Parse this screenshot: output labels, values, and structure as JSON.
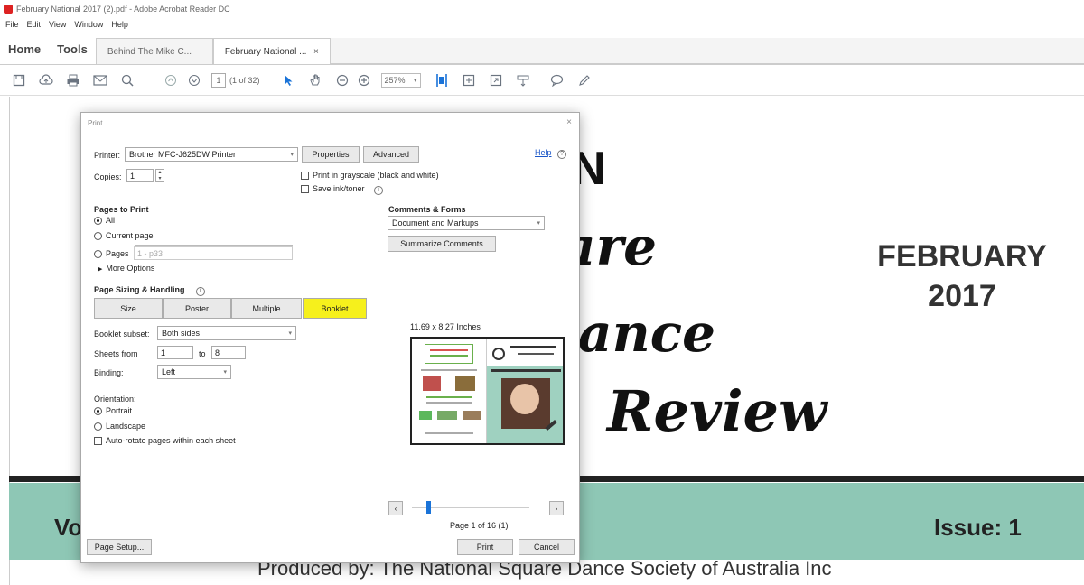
{
  "window": {
    "title": "February National 2017 (2).pdf - Adobe Acrobat Reader DC"
  },
  "menu": [
    "File",
    "Edit",
    "View",
    "Window",
    "Help"
  ],
  "tabs": {
    "home": "Home",
    "tools": "Tools",
    "doc1": "Behind The Mike C...",
    "doc2": "February National ...",
    "close": "×"
  },
  "toolbar": {
    "page_current": "1",
    "page_of": "(1 of 32)",
    "zoom": "257%",
    "icons": [
      "save-icon",
      "upload-icon",
      "print-icon",
      "email-icon",
      "search-icon",
      "page-up-icon",
      "page-down-icon",
      "select-arrow-icon",
      "hand-icon",
      "zoom-out-icon",
      "zoom-in-icon",
      "fit-page-icon",
      "scroll-icon",
      "fullscreen-icon",
      "read-mode-icon",
      "comment-icon",
      "pen-icon"
    ]
  },
  "document": {
    "title_fragment": "N",
    "script_line1": "are",
    "script_line2": "ance",
    "script_line3": "Review",
    "month": "FEBRUARY",
    "year": "2017",
    "volume_fragment": "Vo",
    "issue": "Issue: 1",
    "produced_by": "Produced by: The National Square Dance Society of Australia Inc"
  },
  "dialog": {
    "title": "Print",
    "close": "×",
    "help": "Help",
    "printer_label": "Printer:",
    "printer_value": "Brother MFC-J625DW Printer",
    "properties": "Properties",
    "advanced": "Advanced",
    "copies_label": "Copies:",
    "copies_value": "1",
    "grayscale": "Print in grayscale (black and white)",
    "save_ink": "Save ink/toner",
    "pages_to_print": "Pages to Print",
    "all": "All",
    "current_page": "Current page",
    "pages": "Pages",
    "pages_value": "1 - p33",
    "more_options": "More Options",
    "comments_forms": "Comments & Forms",
    "comments_value": "Document and Markups",
    "summarize": "Summarize Comments",
    "page_sizing": "Page Sizing & Handling",
    "size": "Size",
    "poster": "Poster",
    "multiple": "Multiple",
    "booklet": "Booklet",
    "booklet_subset_label": "Booklet subset:",
    "booklet_subset_value": "Both sides",
    "sheets_from_label": "Sheets from",
    "sheets_from": "1",
    "to_label": "to",
    "sheets_to": "8",
    "binding_label": "Binding:",
    "binding_value": "Left",
    "orientation": "Orientation:",
    "portrait": "Portrait",
    "landscape": "Landscape",
    "auto_rotate": "Auto-rotate pages within each sheet",
    "preview_size": "11.69 x 8.27 Inches",
    "page_count": "Page 1 of 16 (1)",
    "page_setup": "Page Setup...",
    "print": "Print",
    "cancel": "Cancel"
  },
  "colors": {
    "booklet_active": "#f6f01c",
    "band": "#8ec7b5",
    "accent_blue": "#1a73d8"
  }
}
